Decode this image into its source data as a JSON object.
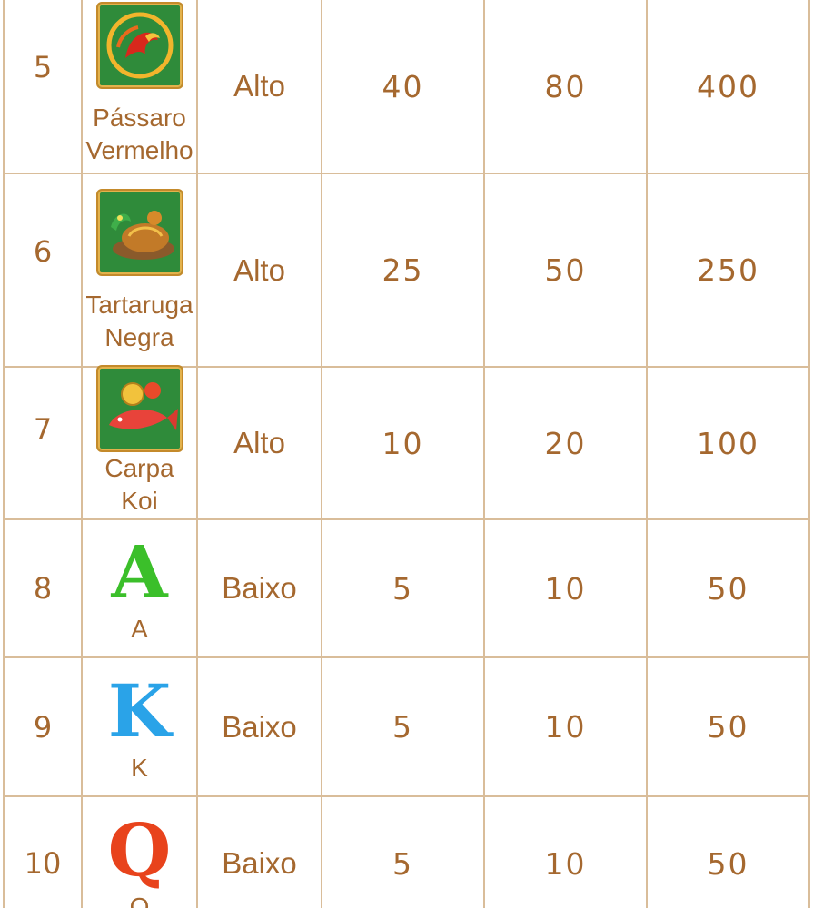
{
  "rows": [
    {
      "num": "5",
      "name_l1": "Pássaro",
      "name_l2": "Vermelho",
      "icon": "red-bird-icon",
      "volatility": "Alto",
      "pay1": "40",
      "pay2": "80",
      "pay3": "400"
    },
    {
      "num": "6",
      "name_l1": "Tartaruga",
      "name_l2": "Negra",
      "icon": "black-turtle-icon",
      "volatility": "Alto",
      "pay1": "25",
      "pay2": "50",
      "pay3": "250"
    },
    {
      "num": "7",
      "name_l1": "Carpa",
      "name_l2": "Koi",
      "icon": "koi-carp-icon",
      "volatility": "Alto",
      "pay1": "10",
      "pay2": "20",
      "pay3": "100"
    },
    {
      "num": "8",
      "letter": "A",
      "name_l1": "A",
      "icon": "letter-a-icon",
      "letter_color": "#3bbf2a",
      "volatility": "Baixo",
      "pay1": "5",
      "pay2": "10",
      "pay3": "50"
    },
    {
      "num": "9",
      "letter": "K",
      "name_l1": "K",
      "icon": "letter-k-icon",
      "letter_color": "#2aa3e8",
      "volatility": "Baixo",
      "pay1": "5",
      "pay2": "10",
      "pay3": "50"
    },
    {
      "num": "10",
      "letter": "Q",
      "name_l1": "Q",
      "icon": "letter-q-icon",
      "letter_color": "#e8431c",
      "volatility": "Baixo",
      "pay1": "5",
      "pay2": "10",
      "pay3": "50"
    }
  ],
  "colors": {
    "text": "#a5682f",
    "border": "#d9bd9a",
    "tile_green": "#2f8b3a",
    "tile_gold": "#c48a2b"
  }
}
